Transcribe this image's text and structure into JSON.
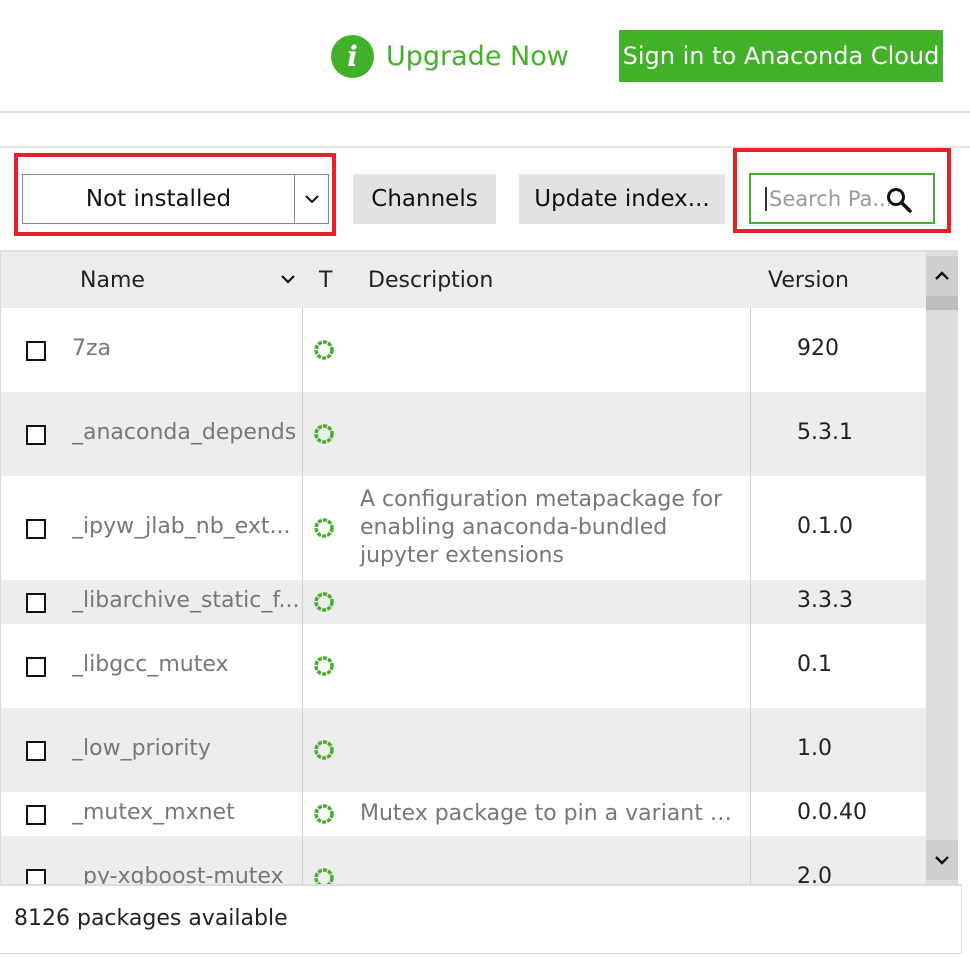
{
  "header": {
    "upgrade_icon": "i",
    "upgrade_label": "Upgrade Now",
    "signin_label": "Sign in to Anaconda Cloud"
  },
  "toolbar": {
    "filter_value": "Not installed",
    "channels_label": "Channels",
    "update_label": "Update index...",
    "search_placeholder": "Search Pa..."
  },
  "table": {
    "columns": {
      "name": "Name",
      "type": "T",
      "description": "Description",
      "version": "Version"
    },
    "rows": [
      {
        "name": "7za",
        "description": "",
        "version": "920"
      },
      {
        "name": "_anaconda_depends",
        "description": "",
        "version": "5.3.1"
      },
      {
        "name": "_ipyw_jlab_nb_ext...",
        "description": "A configuration metapackage for enabling anaconda-bundled jupyter extensions",
        "version": "0.1.0"
      },
      {
        "name": "_libarchive_static_f...",
        "description": "",
        "version": "3.3.3"
      },
      {
        "name": "_libgcc_mutex",
        "description": "",
        "version": "0.1"
      },
      {
        "name": "_low_priority",
        "description": "",
        "version": "1.0"
      },
      {
        "name": "_mutex_mxnet",
        "description": "Mutex package to pin a variant of ...",
        "version": "0.0.40"
      },
      {
        "name": "_py-xgboost-mutex",
        "description": "",
        "version": "2.0"
      }
    ]
  },
  "footer": {
    "status": "8126 packages available"
  },
  "colors": {
    "accent": "#43b02a",
    "highlight": "#e8202a"
  },
  "icons": {
    "status": "status-ring-icon",
    "search": "search-icon",
    "dropdown": "chevron-down-icon",
    "scroll_up": "chevron-up-icon",
    "scroll_down": "chevron-down-icon"
  }
}
